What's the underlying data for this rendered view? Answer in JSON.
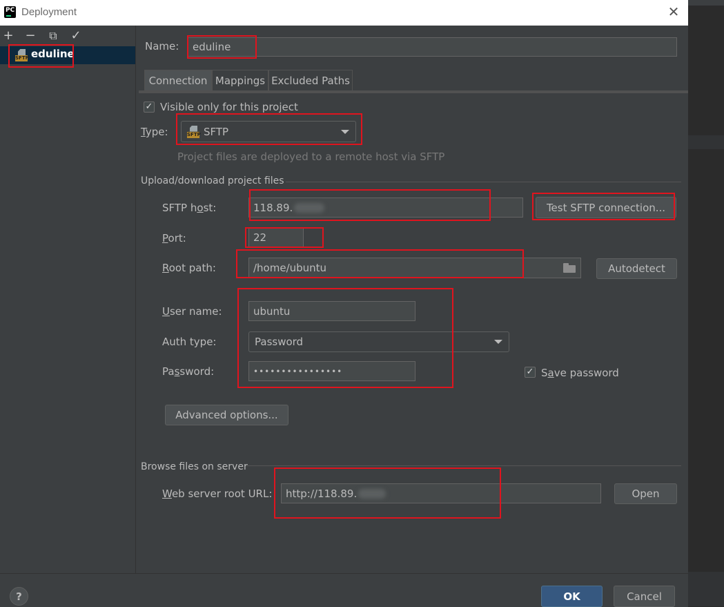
{
  "window": {
    "title": "Deployment",
    "close_glyph": "✕"
  },
  "toolbar": {
    "add": "+",
    "remove": "−",
    "copy": "⧉",
    "check": "✓"
  },
  "server_list": [
    {
      "label": "eduline",
      "icon": "sftp-server-icon"
    }
  ],
  "icon_badge": "SFTP",
  "name_field": {
    "label": "Name:",
    "value": "eduline"
  },
  "tabs": [
    {
      "label": "Connection",
      "active": true
    },
    {
      "label": "Mappings",
      "active": false
    },
    {
      "label": "Excluded Paths",
      "active": false
    }
  ],
  "visible_only": {
    "label": "Visible only for this project",
    "checked": true
  },
  "type_field": {
    "label": "Type:",
    "value": "SFTP",
    "hint": "Project files are deployed to a remote host via SFTP"
  },
  "upload_group": {
    "title": "Upload/download project files"
  },
  "sftp_host": {
    "label": "SFTP host:",
    "value": "118.89."
  },
  "test_button": "Test SFTP connection...",
  "port": {
    "label": "Port:",
    "value": "22"
  },
  "root_path": {
    "label": "Root path:",
    "value": "/home/ubuntu"
  },
  "autodetect_button": "Autodetect",
  "user_name": {
    "label": "User name:",
    "value": "ubuntu"
  },
  "auth_type": {
    "label": "Auth type:",
    "value": "Password"
  },
  "password": {
    "label": "Password:",
    "value": "••••••••••••••••"
  },
  "save_password": {
    "label": "Save password",
    "checked": true
  },
  "advanced_button": "Advanced options...",
  "browse_group": {
    "title": "Browse files on server"
  },
  "web_url": {
    "label": "Web server root URL:",
    "value": "http://118.89."
  },
  "open_button": "Open",
  "footer": {
    "help": "?",
    "ok": "OK",
    "cancel": "Cancel"
  },
  "colors": {
    "dialog_bg": "#3c3f41",
    "selection": "#0d293e",
    "accent_ok": "#365880",
    "highlight_box": "#e0141e"
  }
}
